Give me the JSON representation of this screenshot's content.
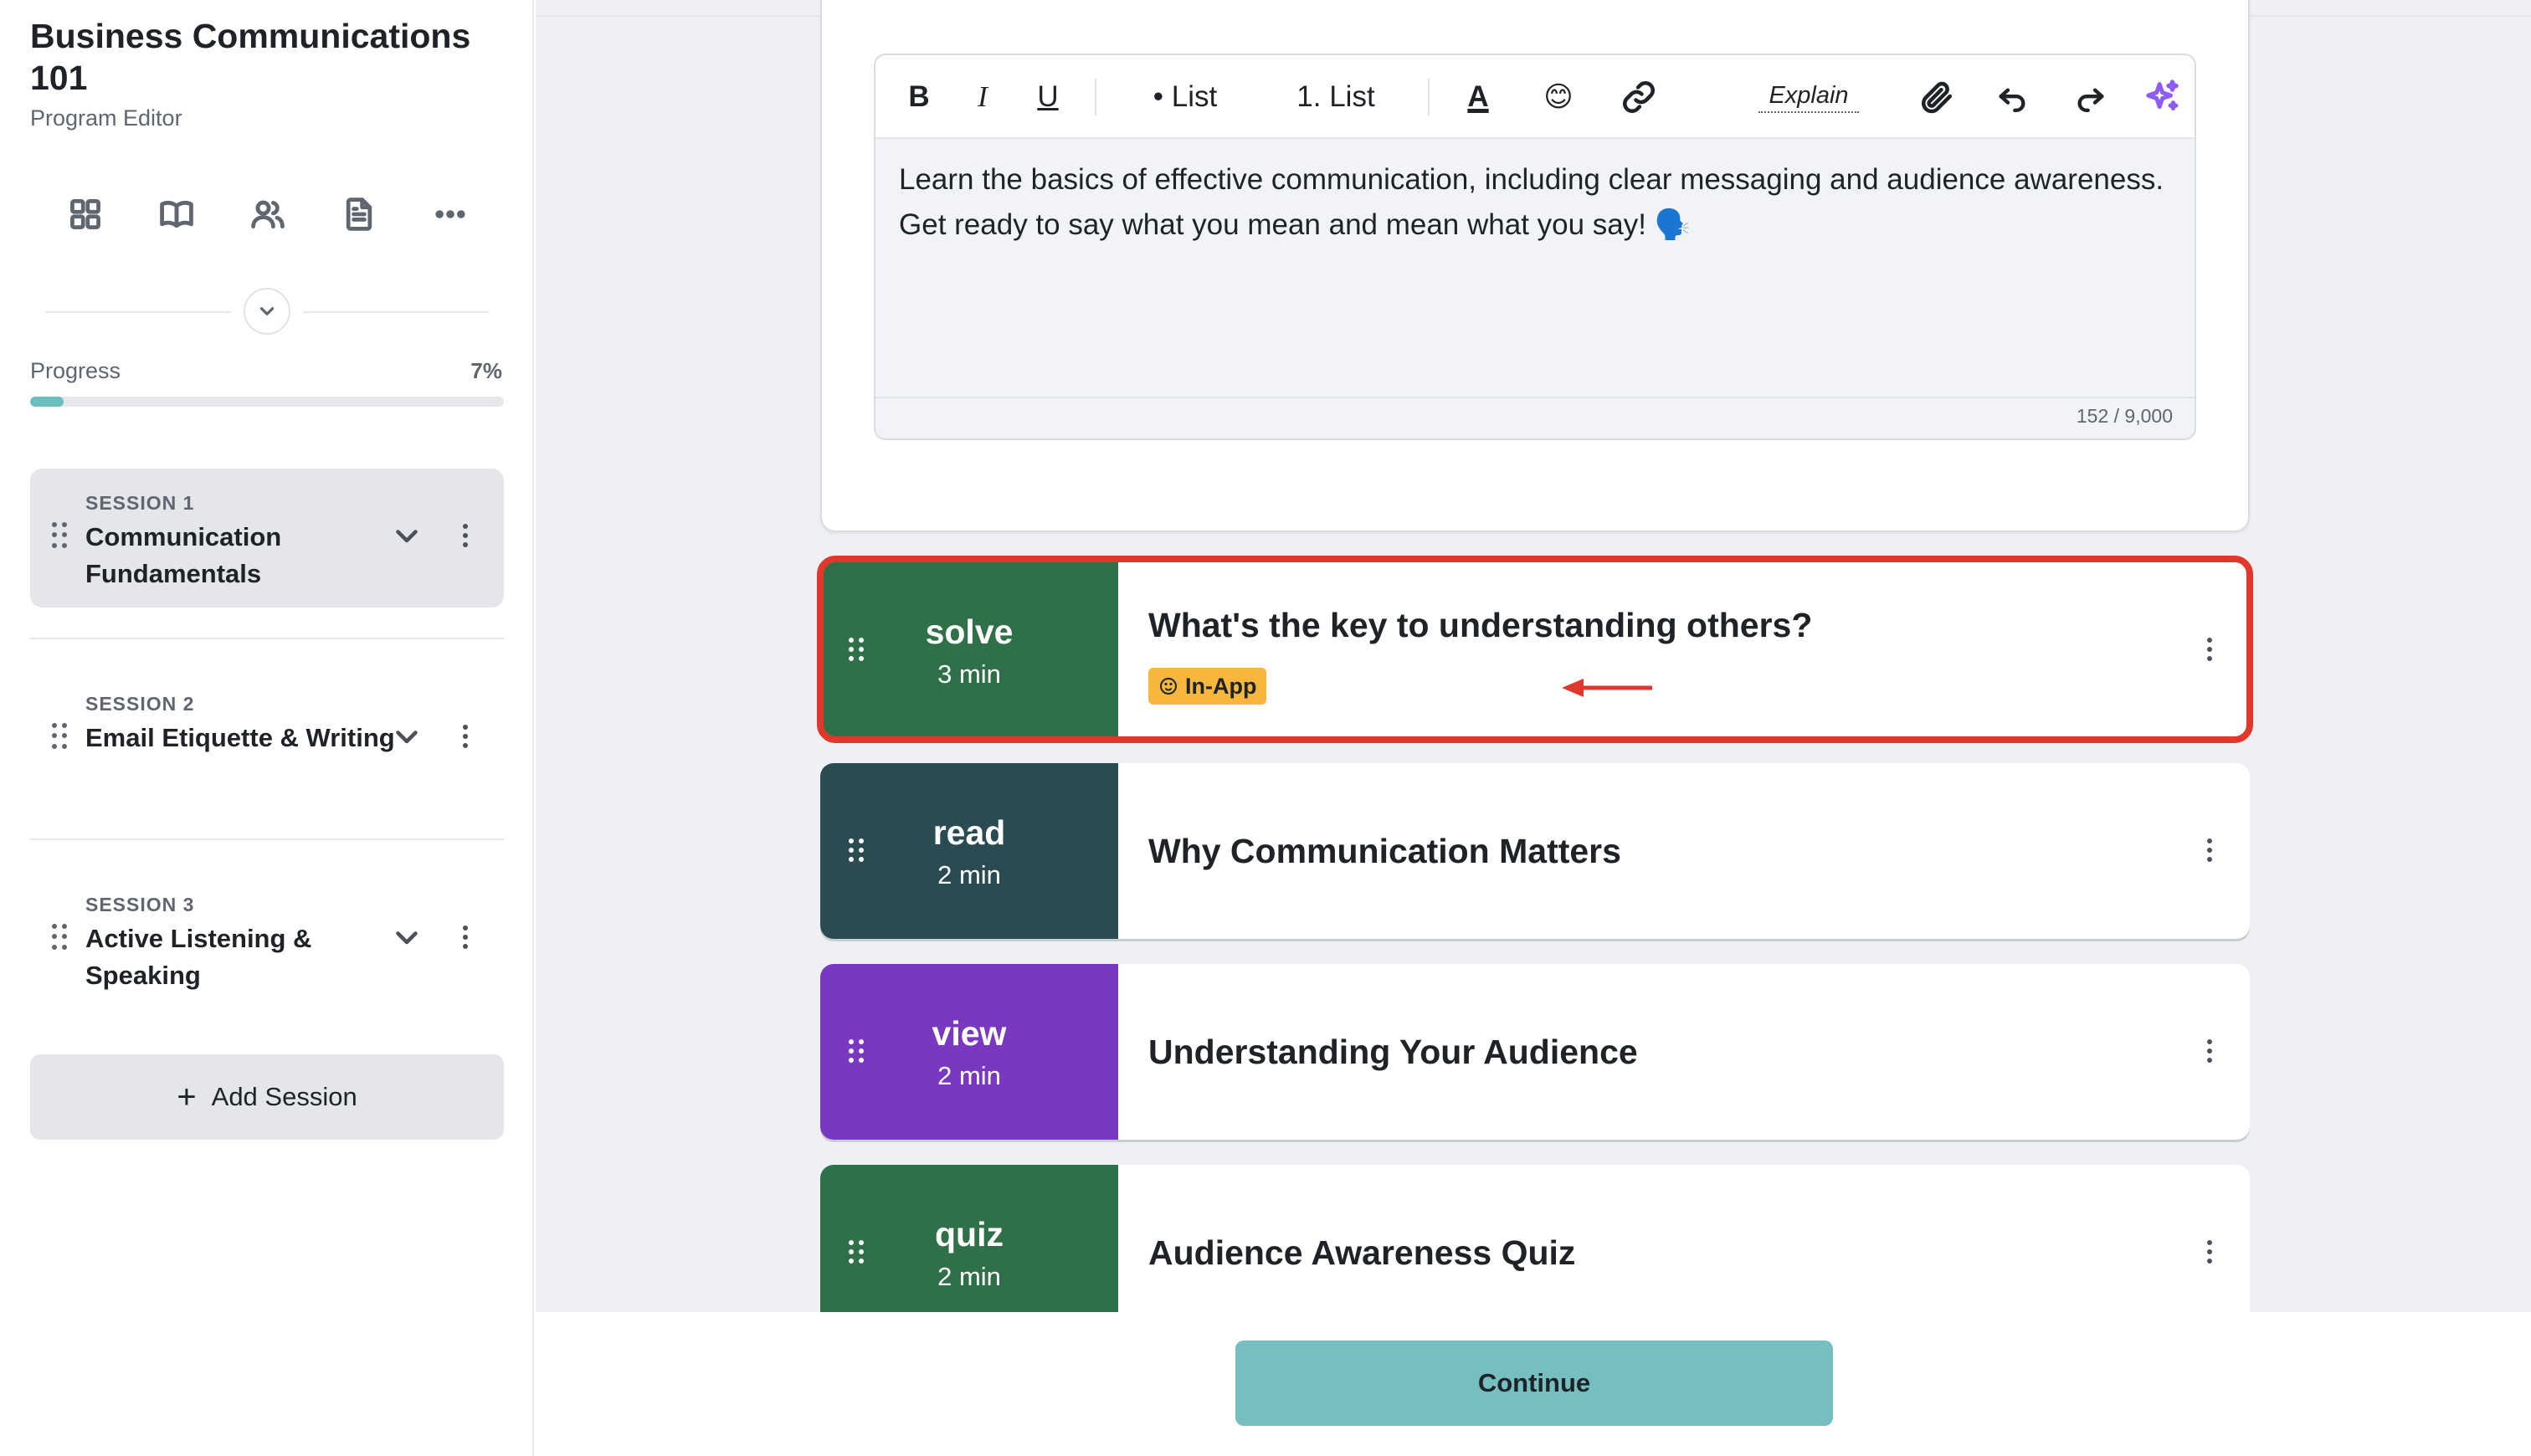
{
  "sidebar": {
    "title": "Business Communications 101",
    "subtitle": "Program Editor",
    "nav_icons": [
      "grid-icon",
      "book-icon",
      "users-icon",
      "document-icon",
      "more-icon"
    ],
    "progress": {
      "label": "Progress",
      "value_text": "7%",
      "fraction": 0.07
    },
    "sessions": [
      {
        "label": "SESSION 1",
        "name": "Communication Fundamentals",
        "active": true
      },
      {
        "label": "SESSION 2",
        "name": "Email Etiquette & Writing",
        "active": false
      },
      {
        "label": "SESSION 3",
        "name": "Active Listening & Speaking",
        "active": false
      }
    ],
    "add_session_label": "Add Session"
  },
  "editor": {
    "toolbar": {
      "bold": "B",
      "italic": "I",
      "underline": "U",
      "bullet_list": "• List",
      "numbered_list": "1. List",
      "text_color": "A",
      "emoji": "😊",
      "explain": "Explain"
    },
    "content": "Learn the basics of effective communication, including clear messaging and audience awareness. Get ready to say what you mean and mean what you say! 🗣️",
    "char_count": "152 / 9,000"
  },
  "steps": [
    {
      "type": "solve",
      "duration": "3 min",
      "title": "What's the key to understanding others?",
      "badge_color": "#2f7048",
      "tag": "In-App",
      "highlighted": true
    },
    {
      "type": "read",
      "duration": "2 min",
      "title": "Why Communication Matters",
      "badge_color": "#2a4b52"
    },
    {
      "type": "view",
      "duration": "2 min",
      "title": "Understanding Your Audience",
      "badge_color": "#7a38c0"
    },
    {
      "type": "quiz",
      "duration": "2 min",
      "title": "Audience Awareness Quiz",
      "badge_color": "#2f7048"
    }
  ],
  "colors": {
    "accent_teal": "#76bfc1",
    "highlight_red": "#e0392b",
    "tag_yellow": "#f6b73c",
    "ai_purple": "#8b5cf6"
  },
  "footer": {
    "continue_label": "Continue"
  }
}
